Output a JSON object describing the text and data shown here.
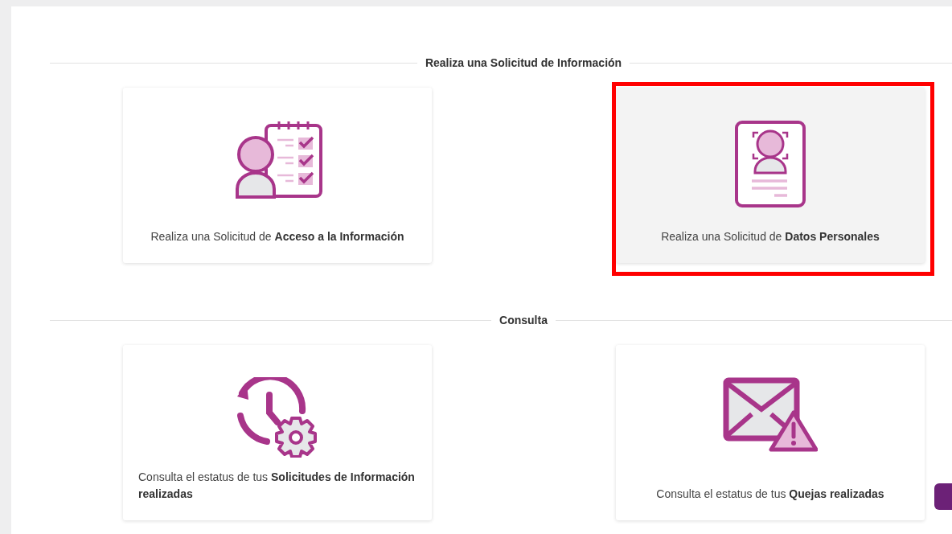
{
  "sections": [
    {
      "title": "Realiza una Solicitud de Información",
      "cards": [
        {
          "kind": "checklist",
          "text": "Realiza una Solicitud de **Acceso a la Información**",
          "selected": false
        },
        {
          "kind": "idcard",
          "text": "Realiza una Solicitud de **Datos Personales**",
          "selected": true
        }
      ]
    },
    {
      "title": "Consulta",
      "cards": [
        {
          "kind": "history",
          "text": "Consulta el estatus de tus **Solicitudes de Información realizadas**",
          "selected": false
        },
        {
          "kind": "mail",
          "text": "Consulta el estatus de tus **Quejas realizadas**",
          "selected": false
        }
      ]
    }
  ]
}
